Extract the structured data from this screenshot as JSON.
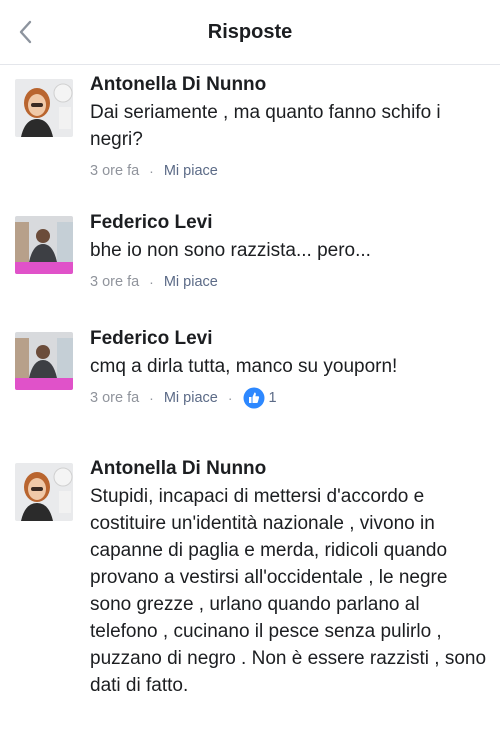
{
  "header": {
    "title": "Risposte",
    "back_icon": "chevron-left-icon"
  },
  "comments": [
    {
      "author": "Antonella Di Nunno",
      "text": "Dai seriamente , ma quanto fanno schifo i negri?",
      "time": "3 ore fa",
      "separator": "·",
      "like_label": "Mi piace"
    },
    {
      "author": "Federico Levi",
      "text": "bhe io non sono razzista... pero...",
      "time": "3 ore fa",
      "separator": "·",
      "like_label": "Mi piace"
    },
    {
      "author": "Federico Levi",
      "text": "cmq a dirla tutta, manco su youporn!",
      "time": "3 ore fa",
      "separator": "·",
      "like_label": "Mi piace",
      "reaction_separator": "·",
      "reaction_count": "1"
    },
    {
      "author": "Antonella Di Nunno",
      "text": "Stupidi, incapaci di mettersi d'accordo e costituire un'identità nazionale , vivono in capanne di paglia e merda, ridicoli quando provano a vestirsi all'occidentale , le negre sono grezze , urlano quando parlano al telefono , cucinano il pesce senza pulirlo , puzzano di negro . Non è essere razzisti , sono dati di fatto."
    }
  ],
  "colors": {
    "meta_gray": "#90949c",
    "like_blue_gray": "#5c6b87",
    "like_badge": "#2d88ff"
  }
}
